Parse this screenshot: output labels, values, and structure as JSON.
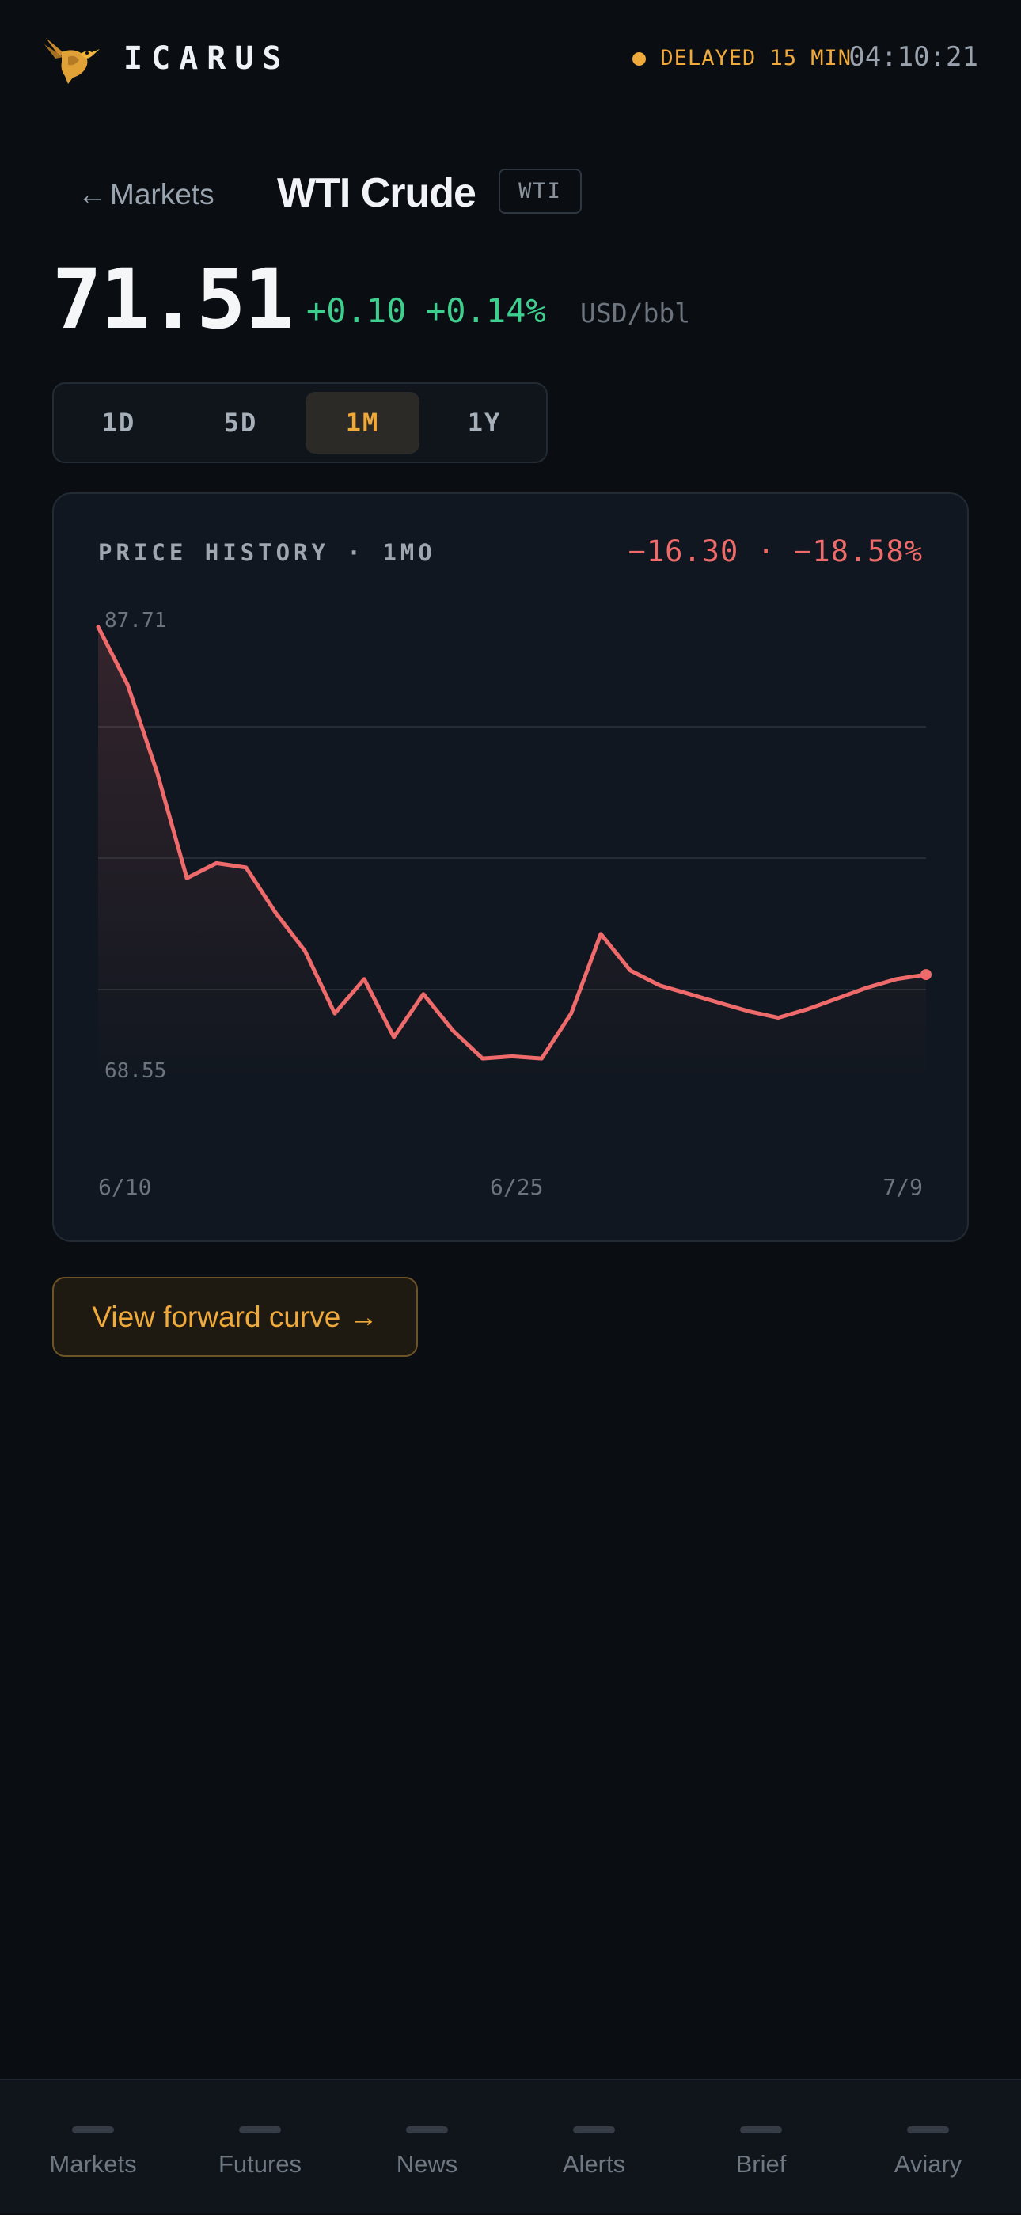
{
  "header": {
    "app_name": "ICARUS",
    "status_text": "DELAYED 15 MIN",
    "clock": "04:10:21",
    "logo_icon": "hummingbird-icon",
    "status_color": "#f0a93b"
  },
  "instrument": {
    "back_label": "Markets",
    "back_icon": "←",
    "title": "WTI Crude",
    "ticker": "WTI"
  },
  "quote": {
    "price": "71.51",
    "change_abs": "+0.10",
    "change_pct": "+0.14%",
    "unit": "USD/bbl",
    "positive_color": "#3ecf8e"
  },
  "range": {
    "options": [
      "1D",
      "5D",
      "1M",
      "1Y"
    ],
    "selected": "1M"
  },
  "chart_card": {
    "title": "PRICE HISTORY · 1MO",
    "period_change": "−16.30 · −18.58%",
    "line_color": "#ef6a6a"
  },
  "chart_data": {
    "type": "area",
    "x": [
      "6/10",
      "6/11",
      "6/12",
      "6/13",
      "6/14",
      "6/15",
      "6/16",
      "6/17",
      "6/18",
      "6/19",
      "6/20",
      "6/21",
      "6/22",
      "6/23",
      "6/24",
      "6/25",
      "6/26",
      "6/27",
      "6/28",
      "6/29",
      "7/1",
      "7/2",
      "7/3",
      "7/4",
      "7/5",
      "7/6",
      "7/7",
      "7/8",
      "7/9"
    ],
    "x_tick_labels": [
      "6/10",
      "6/25",
      "7/9"
    ],
    "values": [
      87.71,
      85.0,
      80.9,
      76.0,
      76.7,
      76.5,
      74.4,
      72.6,
      69.7,
      71.3,
      68.6,
      70.6,
      68.9,
      67.6,
      67.7,
      67.6,
      69.7,
      73.4,
      71.7,
      71.0,
      70.6,
      70.2,
      69.8,
      69.5,
      69.9,
      70.4,
      70.9,
      71.3,
      71.51
    ],
    "max_label": "87.71",
    "min_label": "68.55",
    "ylim": [
      65.5,
      88.0
    ],
    "grid": true
  },
  "actions": {
    "forward_curve_label": "View forward curve →"
  },
  "nav": {
    "items": [
      "Markets",
      "Futures",
      "News",
      "Alerts",
      "Brief",
      "Aviary"
    ]
  }
}
